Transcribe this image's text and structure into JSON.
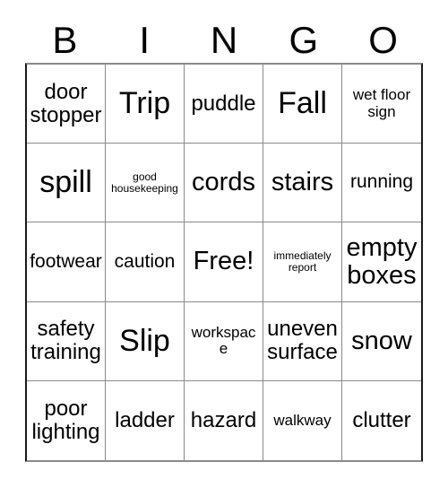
{
  "card": {
    "title": "BINGO card",
    "headers": [
      "B",
      "I",
      "N",
      "G",
      "O"
    ],
    "colors": {
      "background": "#ffffff",
      "text": "#000000",
      "grid_line": "#8a8a8a",
      "outer_border": "#1a1a1a"
    },
    "rows": [
      [
        {
          "text": "door stopper",
          "size": "sz-md"
        },
        {
          "text": "Trip",
          "size": "sz-xl"
        },
        {
          "text": "puddle",
          "size": "sz-md"
        },
        {
          "text": "Fall",
          "size": "sz-xl"
        },
        {
          "text": "wet floor sign",
          "size": "sz-xs"
        }
      ],
      [
        {
          "text": "spill",
          "size": "sz-xl"
        },
        {
          "text": "good housekeeping",
          "size": "sz-xxs"
        },
        {
          "text": "cords",
          "size": "sz-lg"
        },
        {
          "text": "stairs",
          "size": "sz-lg"
        },
        {
          "text": "running",
          "size": "sz-sm"
        }
      ],
      [
        {
          "text": "footwear",
          "size": "sz-sm"
        },
        {
          "text": "caution",
          "size": "sz-sm"
        },
        {
          "text": "Free!",
          "size": "sz-lg"
        },
        {
          "text": "immediately report",
          "size": "sz-xxs"
        },
        {
          "text": "empty boxes",
          "size": "sz-lg"
        }
      ],
      [
        {
          "text": "safety training",
          "size": "sz-md"
        },
        {
          "text": "Slip",
          "size": "sz-xl"
        },
        {
          "text": "workspace",
          "size": "sz-xs"
        },
        {
          "text": "uneven surface",
          "size": "sz-md"
        },
        {
          "text": "snow",
          "size": "sz-lg"
        }
      ],
      [
        {
          "text": "poor lighting",
          "size": "sz-md"
        },
        {
          "text": "ladder",
          "size": "sz-md"
        },
        {
          "text": "hazard",
          "size": "sz-md"
        },
        {
          "text": "walkway",
          "size": "sz-xs"
        },
        {
          "text": "clutter",
          "size": "sz-md"
        }
      ]
    ]
  }
}
